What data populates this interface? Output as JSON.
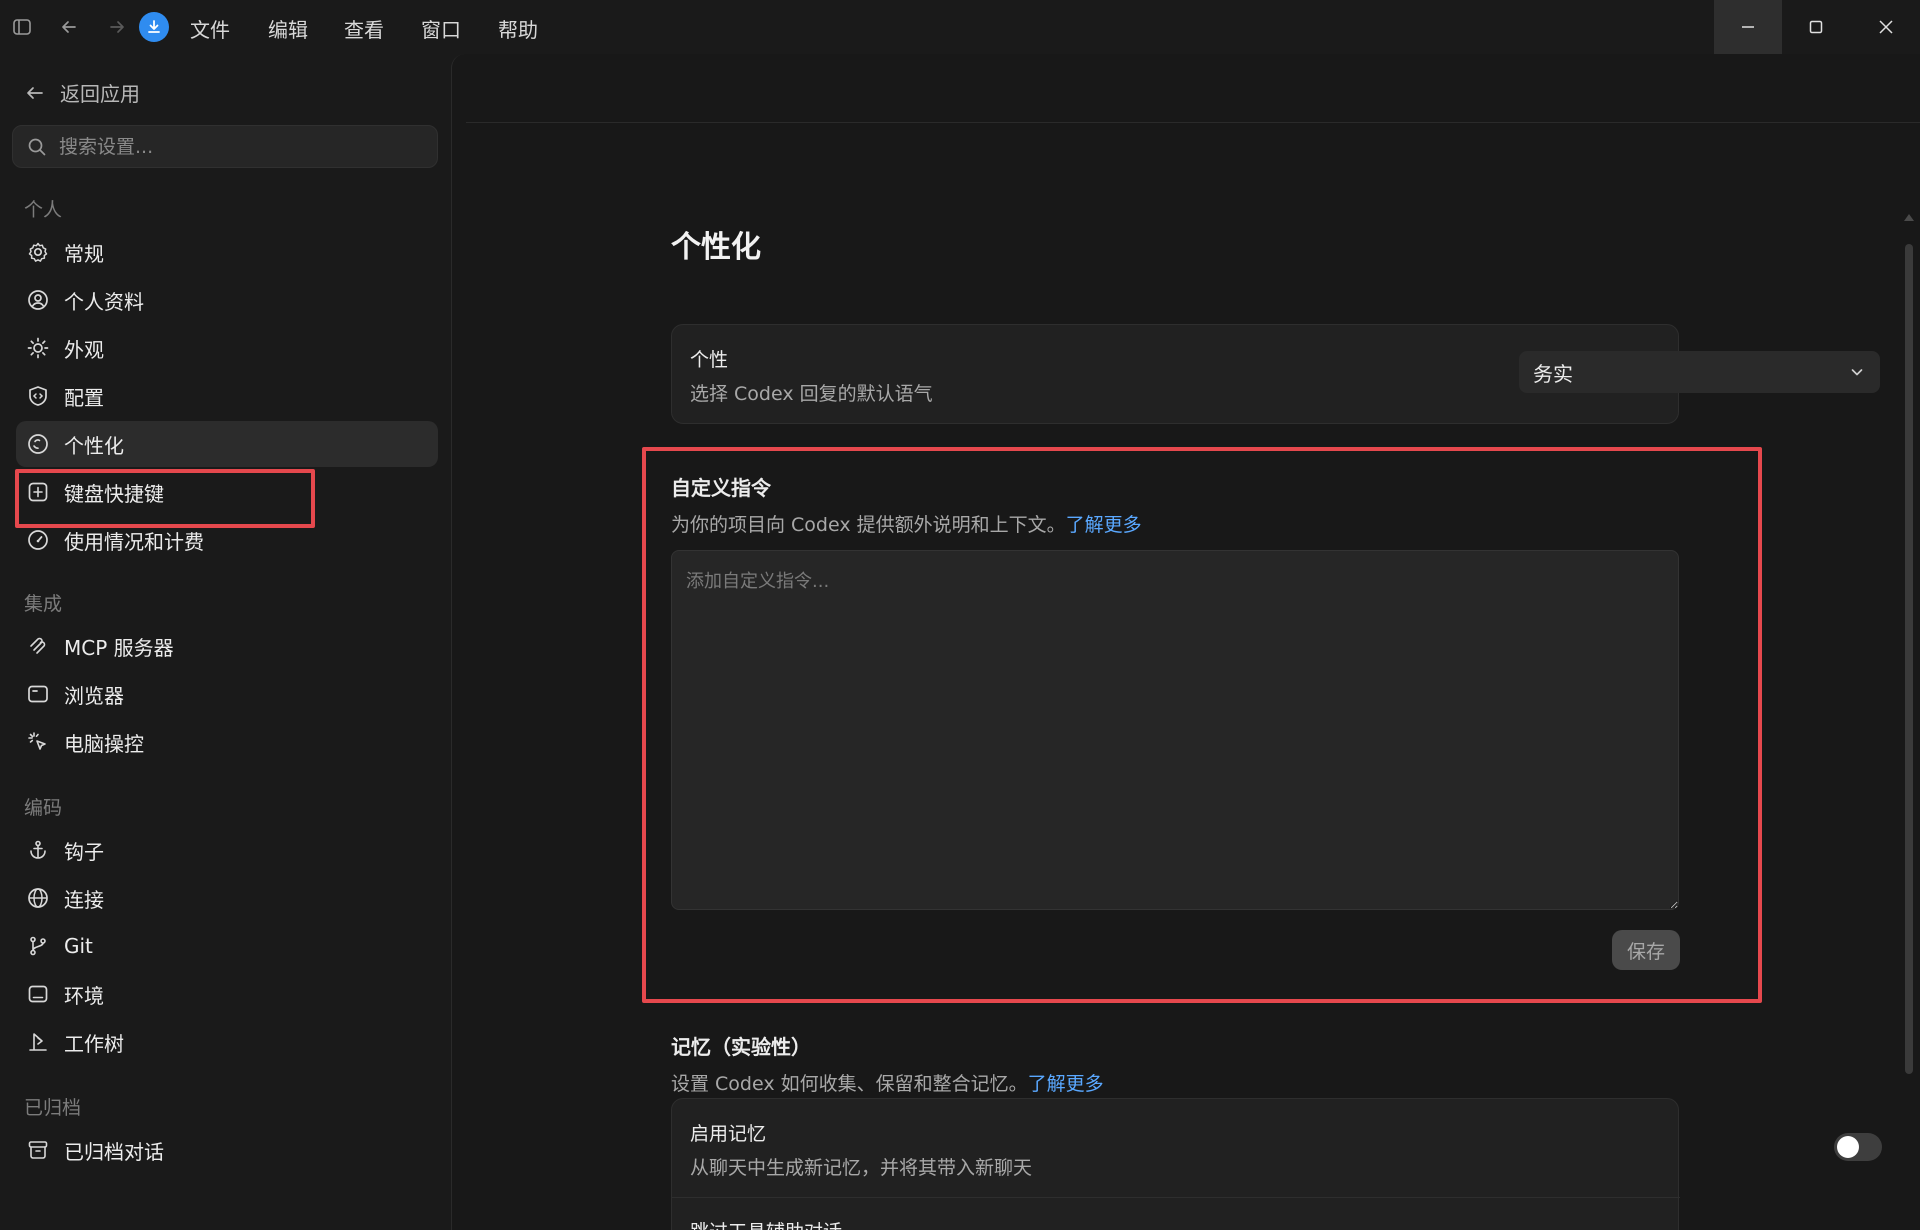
{
  "titlebar": {
    "menu": [
      "文件",
      "编辑",
      "查看",
      "窗口",
      "帮助"
    ]
  },
  "sidebar": {
    "back_label": "返回应用",
    "search_placeholder": "搜索设置...",
    "sections": [
      {
        "label": "个人",
        "items": [
          "常规",
          "个人资料",
          "外观",
          "配置",
          "个性化",
          "键盘快捷键",
          "使用情况和计费"
        ]
      },
      {
        "label": "集成",
        "items": [
          "MCP 服务器",
          "浏览器",
          "电脑操控"
        ]
      },
      {
        "label": "编码",
        "items": [
          "钩子",
          "连接",
          "Git",
          "环境",
          "工作树"
        ]
      },
      {
        "label": "已归档",
        "items": [
          "已归档对话"
        ]
      }
    ],
    "active_item": "个性化"
  },
  "main": {
    "title": "个性化",
    "personality": {
      "title": "个性",
      "subtitle": "选择 Codex 回复的默认语气",
      "selected": "务实"
    },
    "custom_instructions": {
      "title": "自定义指令",
      "desc": "为你的项目向 Codex 提供额外说明和上下文。",
      "link": "了解更多",
      "placeholder": "添加自定义指令...",
      "save_label": "保存"
    },
    "memory": {
      "title": "记忆（实验性）",
      "desc": "设置 Codex 如何收集、保留和整合记忆。",
      "link": "了解更多",
      "enable_title": "启用记忆",
      "enable_sub": "从聊天中生成新记忆，并将其带入新聊天",
      "enabled": false,
      "next_row_title": "跳过工具辅助对话"
    }
  },
  "colors": {
    "accent_link": "#5aa8ff",
    "highlight": "#e5484d"
  }
}
